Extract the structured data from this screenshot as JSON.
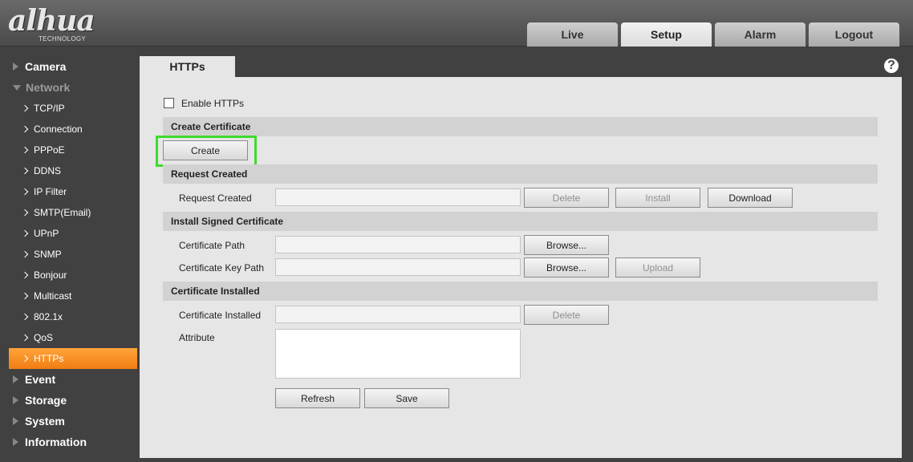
{
  "header": {
    "logo_main": "alhua",
    "logo_sub": "TECHNOLOGY",
    "tabs": [
      {
        "label": "Live"
      },
      {
        "label": "Setup"
      },
      {
        "label": "Alarm"
      },
      {
        "label": "Logout"
      }
    ],
    "active_tab": "Setup"
  },
  "sidebar": {
    "camera": "Camera",
    "network": "Network",
    "network_items": [
      "TCP/IP",
      "Connection",
      "PPPoE",
      "DDNS",
      "IP Filter",
      "SMTP(Email)",
      "UPnP",
      "SNMP",
      "Bonjour",
      "Multicast",
      "802.1x",
      "QoS",
      "HTTPs"
    ],
    "active_item": "HTTPs",
    "event": "Event",
    "storage": "Storage",
    "system": "System",
    "information": "Information"
  },
  "page": {
    "tab_title": "HTTPs",
    "help_icon": "?",
    "enable_label": "Enable HTTPs",
    "enable_checked": false,
    "sections": {
      "create": "Create Certificate",
      "request": "Request Created",
      "install": "Install Signed Certificate",
      "installed": "Certificate Installed"
    },
    "buttons": {
      "create": "Create",
      "delete": "Delete",
      "install": "Install",
      "download": "Download",
      "browse": "Browse...",
      "upload": "Upload",
      "refresh": "Refresh",
      "save": "Save"
    },
    "labels": {
      "request_created": "Request Created",
      "certificate_path": "Certificate Path",
      "certificate_key_path": "Certificate Key Path",
      "certificate_installed": "Certificate Installed",
      "attribute": "Attribute"
    },
    "values": {
      "request_created": "",
      "certificate_path": "",
      "certificate_key_path": "",
      "certificate_installed": "",
      "attribute": ""
    }
  },
  "colors": {
    "active_sidebar": "#f07d12",
    "highlight": "#3cdc2b"
  }
}
